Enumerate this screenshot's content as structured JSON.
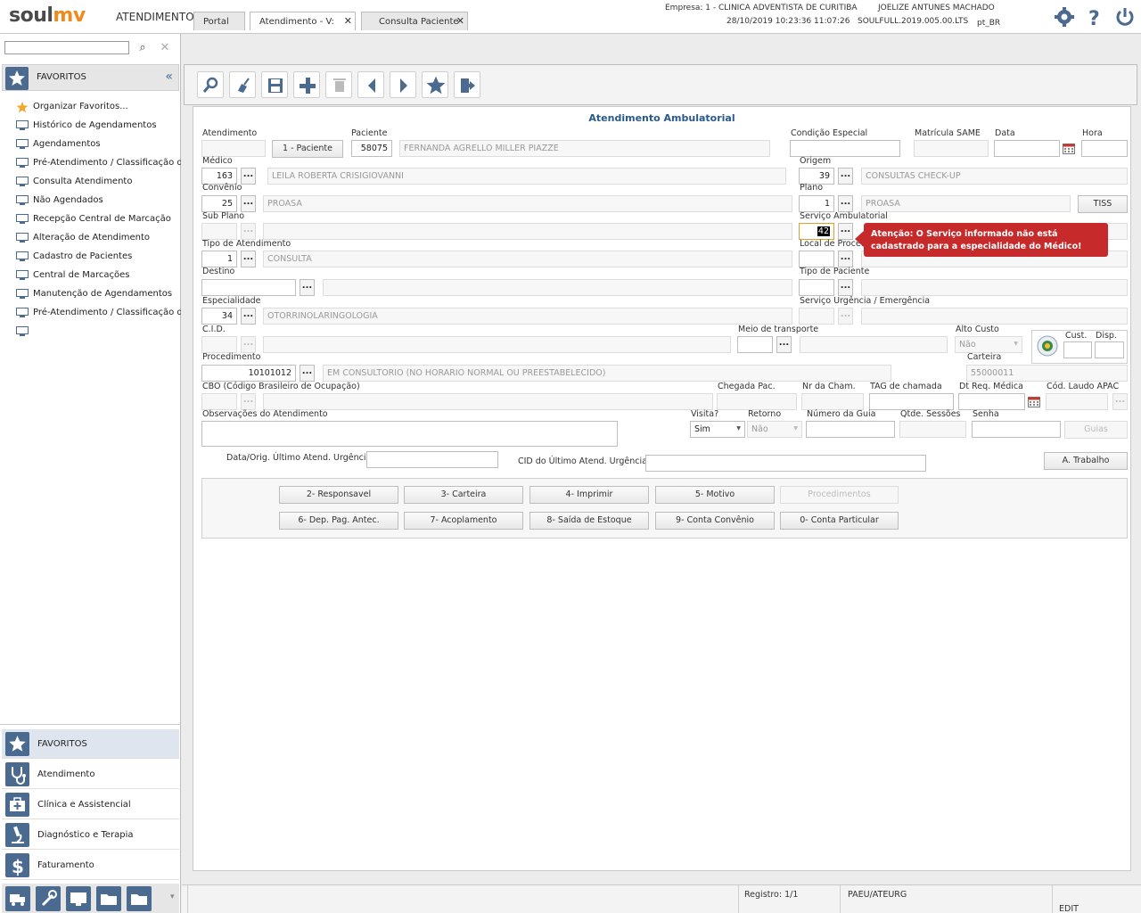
{
  "app": {
    "logo_left": "soul",
    "logo_right": "mv",
    "module": "ATENDIMENTO"
  },
  "header": {
    "empresa": "Empresa: 1 - CLINICA ADVENTISTA DE CURITIBA",
    "user": "JOELIZE ANTUNES MACHADO",
    "datetime": "28/10/2019 10:23:36",
    "time2": "11:07:26",
    "version": "SOULFULL.2019.005.00.LTS",
    "locale": "pt_BR"
  },
  "sidebar": {
    "favorites_title": "FAVORITOS",
    "items": [
      "Organizar Favoritos...",
      "Histórico de Agendamentos",
      "Agendamentos",
      "Pré-Atendimento / Classificação de R",
      "Consulta Atendimento",
      "Não Agendados",
      "Recepção Central de Marcação",
      "Alteração de Atendimento",
      "Cadastro de Pacientes",
      "Central de Marcações",
      "Manutenção de Agendamentos",
      "Pré-Atendimento / Classificação de R"
    ],
    "modules": [
      "FAVORITOS",
      "Atendimento",
      "Clínica e Assistencial",
      "Diagnóstico e Terapia",
      "Faturamento"
    ]
  },
  "tabs": [
    "Portal",
    "Atendimento - V:",
    "Consulta Paciente"
  ],
  "form": {
    "title": "Atendimento Ambulatorial",
    "labels": {
      "atendimento": "Atendimento",
      "paciente": "Paciente",
      "condicao": "Condição Especial",
      "matricula": "Matrícula SAME",
      "data": "Data",
      "hora": "Hora",
      "medico": "Médico",
      "origem": "Origem",
      "convenio": "Convênio",
      "plano": "Plano",
      "subplano": "Sub Plano",
      "servico_amb": "Serviço Ambulatorial",
      "tipo_atend": "Tipo de Atendimento",
      "local_proced": "Local de Proced",
      "destino": "Destino",
      "tipo_paciente": "Tipo de Paciente",
      "especialidade": "Especialidade",
      "servico_urg": "Serviço Urgência / Emergência",
      "cid": "C.I.D.",
      "meio_transp": "Meio de transporte",
      "alto_custo": "Alto Custo",
      "cust": "Cust.",
      "disp": "Disp.",
      "procedimento": "Procedimento",
      "carteira": "Carteira",
      "cbo": "CBO (Código Brasileiro de Ocupação)",
      "chegada": "Chegada Pac.",
      "nr_cham": "Nr da Cham.",
      "tag_cham": "TAG de chamada",
      "dt_req": "Dt Req. Médica",
      "cod_laudo": "Cód. Laudo APAC",
      "obs": "Observações do Atendimento",
      "visita": "Visita?",
      "retorno": "Retorno",
      "num_guia": "Número da Guia",
      "qtde_sessoes": "Qtde. Sessões",
      "senha": "Senha",
      "data_orig": "Data/Orig. Último Atend. Urgência",
      "cid_ultimo": "CID do Último Atend. Urgência"
    },
    "values": {
      "paciente_btn": "1 - Paciente",
      "paciente_cod": "58075",
      "paciente_nome": "FERNANDA AGRELLO MILLER PIAZZE",
      "medico_cod": "163",
      "medico_nome": "LEILA ROBERTA CRISIGIOVANNI",
      "origem_cod": "39",
      "origem_nome": "CONSULTAS CHECK-UP",
      "convenio_cod": "25",
      "convenio_nome": "PROASA",
      "plano_cod": "1",
      "plano_nome": "PROASA",
      "tiss_btn": "TISS",
      "servico_cod": "42",
      "tipo_atend_cod": "1",
      "tipo_atend_nome": "CONSULTA",
      "especialidade_cod": "34",
      "especialidade_nome": "OTORRINOLARINGOLOGIA",
      "alto_custo": "Não",
      "procedimento_cod": "10101012",
      "procedimento_nome": "EM CONSULTORIO (NO HORARIO NORMAL OU PREESTABELECIDO)",
      "carteira": "55000011",
      "visita": "Sim",
      "retorno": "Não",
      "guias_btn": "Guias",
      "trabalho_btn": "A. Trabalho",
      "dots": "..."
    },
    "tooltip": "Atenção: O Serviço informado não está cadastrado para a especialidade do Médico!",
    "buttons_row1": [
      "2- Responsavel",
      "3- Carteira",
      "4- Imprimir",
      "5- Motivo",
      "Procedimentos"
    ],
    "buttons_row2": [
      "6- Dep. Pag. Antec.",
      "7- Acoplamento",
      "8- Saída de Estoque",
      "9- Conta Convênio",
      "0- Conta Particular"
    ]
  },
  "status": {
    "registro": "Registro: 1/1",
    "local": "PAEU/ATEURG",
    "mode": "EDIT"
  },
  "colors": {
    "accent": "#4a6a90",
    "logo_orange": "#f08a1c",
    "alert": "#c62a2a",
    "title_blue": "#2a5a8a"
  }
}
